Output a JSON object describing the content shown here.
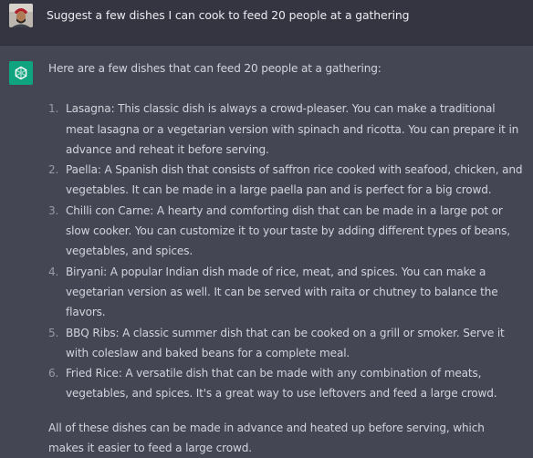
{
  "user_message": "Suggest a few dishes I can cook to feed 20 people at a gathering",
  "assistant": {
    "intro": "Here are a few dishes that can feed 20 people at a gathering:",
    "items": [
      {
        "number": "1.",
        "text": "Lasagna: This classic dish is always a crowd-pleaser. You can make a traditional meat lasagna or a vegetarian version with spinach and ricotta. You can prepare it in advance and reheat it before serving."
      },
      {
        "number": "2.",
        "text": "Paella: A Spanish dish that consists of saffron rice cooked with seafood, chicken, and vegetables. It can be made in a large paella pan and is perfect for a big crowd."
      },
      {
        "number": "3.",
        "text": "Chilli con Carne: A hearty and comforting dish that can be made in a large pot or slow cooker. You can customize it to your taste by adding different types of beans, vegetables, and spices."
      },
      {
        "number": "4.",
        "text": "Biryani: A popular Indian dish made of rice, meat, and spices. You can make a vegetarian version as well. It can be served with raita or chutney to balance the flavors."
      },
      {
        "number": "5.",
        "text": "BBQ Ribs: A classic summer dish that can be cooked on a grill or smoker. Serve it with coleslaw and baked beans for a complete meal."
      },
      {
        "number": "6.",
        "text": "Fried Rice: A versatile dish that can be made with any combination of meats, vegetables, and spices. It's a great way to use leftovers and feed a large crowd."
      }
    ],
    "outro": "All of these dishes can be made in advance and heated up before serving, which makes it easier to feed a large crowd."
  },
  "colors": {
    "user_bg": "#343541",
    "assistant_bg": "#444654",
    "text": "#d1d5db",
    "accent": "#10a37f"
  },
  "icons": {
    "user_avatar": "user-avatar",
    "assistant_avatar": "openai-logo-icon"
  }
}
